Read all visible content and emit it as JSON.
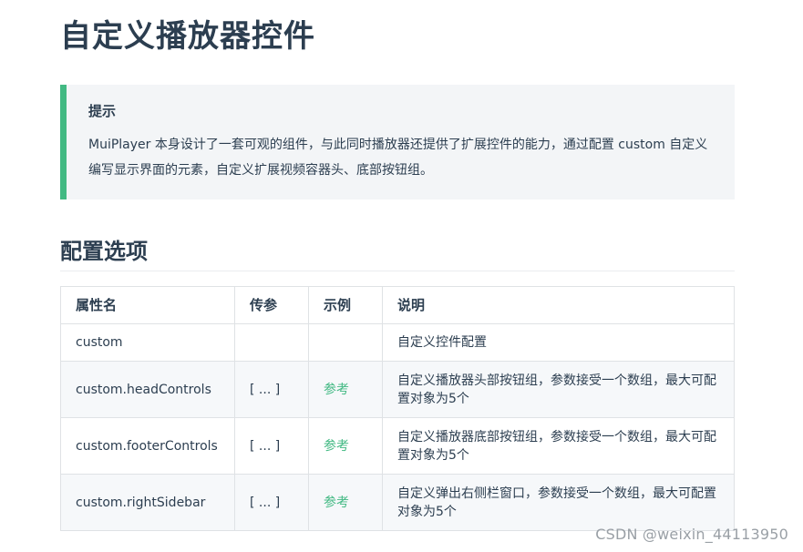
{
  "page": {
    "title": "自定义播放器控件"
  },
  "tip": {
    "title": "提示",
    "body": "MuiPlayer 本身设计了一套可观的组件，与此同时播放器还提供了扩展控件的能力，通过配置 custom 自定义编写显示界面的元素，自定义扩展视频容器头、底部按钮组。"
  },
  "section": {
    "heading": "配置选项"
  },
  "table": {
    "headers": [
      "属性名",
      "传参",
      "示例",
      "说明"
    ],
    "rows": [
      {
        "name": "custom",
        "param": "",
        "example": "",
        "desc": "自定义控件配置"
      },
      {
        "name": "custom.headControls",
        "param": "[ ... ]",
        "example": "参考",
        "desc": "自定义播放器头部按钮组，参数接受一个数组，最大可配置对象为5个"
      },
      {
        "name": "custom.footerControls",
        "param": "[ ... ]",
        "example": "参考",
        "desc": "自定义播放器底部按钮组，参数接受一个数组，最大可配置对象为5个"
      },
      {
        "name": "custom.rightSidebar",
        "param": "[ ... ]",
        "example": "参考",
        "desc": "自定义弹出右侧栏窗口，参数接受一个数组，最大可配置对象为5个"
      }
    ]
  },
  "watermark": "CSDN @weixin_44113950",
  "colors": {
    "accent": "#42b983",
    "text": "#2c3e50",
    "tip_bg": "#f3f5f7",
    "border": "#dfe2e5"
  }
}
